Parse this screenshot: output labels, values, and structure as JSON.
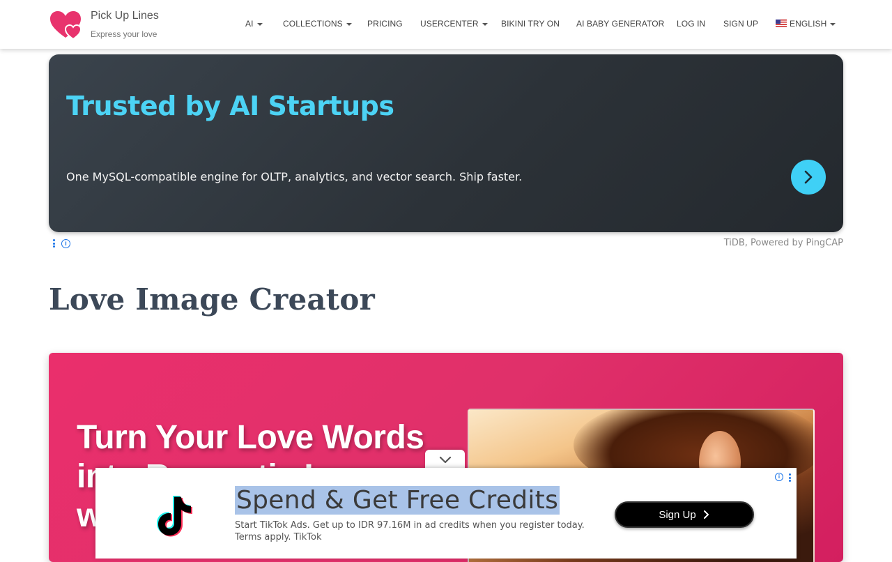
{
  "header": {
    "brand_name": "Pick Up Lines",
    "brand_tagline": "Express your love",
    "nav": [
      {
        "label": "AI",
        "dropdown": true
      },
      {
        "label": "COLLECTIONS",
        "dropdown": true
      },
      {
        "label": "PRICING",
        "dropdown": false
      },
      {
        "label": "USERCENTER",
        "dropdown": true
      },
      {
        "label": "BIKINI TRY ON",
        "dropdown": false
      },
      {
        "label": "AI BABY GENERATOR",
        "dropdown": false
      },
      {
        "label": "LOG IN",
        "dropdown": false
      },
      {
        "label": "SIGN UP",
        "dropdown": false
      },
      {
        "label": "ENGLISH",
        "dropdown": true,
        "icon": "us-flag-icon"
      }
    ]
  },
  "top_ad": {
    "title": "Trusted by AI Startups",
    "description": "One MySQL-compatible engine for OLTP, analytics, and vector search. Ship faster.",
    "source": "TiDB, Powered by PingCAP",
    "accent_color": "#4cd3f5"
  },
  "main": {
    "page_title": "Love Image Creator",
    "hero_heading": "Turn Your Love Words into Romantic Images with Magic",
    "hero_color": "#e0306a"
  },
  "bottom_ad": {
    "title_highlighted": "Spend & Get Free Credits",
    "description": "Start TikTok Ads. Get up to IDR 97.16M in ad credits when you register today. Terms apply. TikTok",
    "cta_label": "Sign Up"
  }
}
